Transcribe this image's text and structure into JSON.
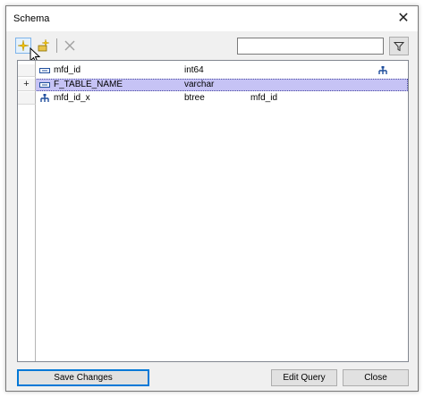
{
  "window": {
    "title": "Schema"
  },
  "filter": {
    "value": "",
    "placeholder": ""
  },
  "rows": [
    {
      "header": "",
      "icon": "column-icon",
      "name": "mfd_id",
      "type": "int64",
      "extra": "",
      "indexed": true
    },
    {
      "header": "+",
      "icon": "column-icon",
      "name": "F_TABLE_NAME",
      "type": "varchar",
      "extra": "",
      "indexed": false,
      "selected": true
    },
    {
      "header": "",
      "icon": "index-icon",
      "name": "mfd_id_x",
      "type": "btree",
      "extra": "mfd_id",
      "indexed": false
    }
  ],
  "buttons": {
    "save": "Save Changes",
    "edit_query": "Edit Query",
    "close": "Close"
  },
  "colors": {
    "selected_row": "#c6c3f5",
    "accent": "#0078d7",
    "icon_blue": "#1f4e9c"
  }
}
